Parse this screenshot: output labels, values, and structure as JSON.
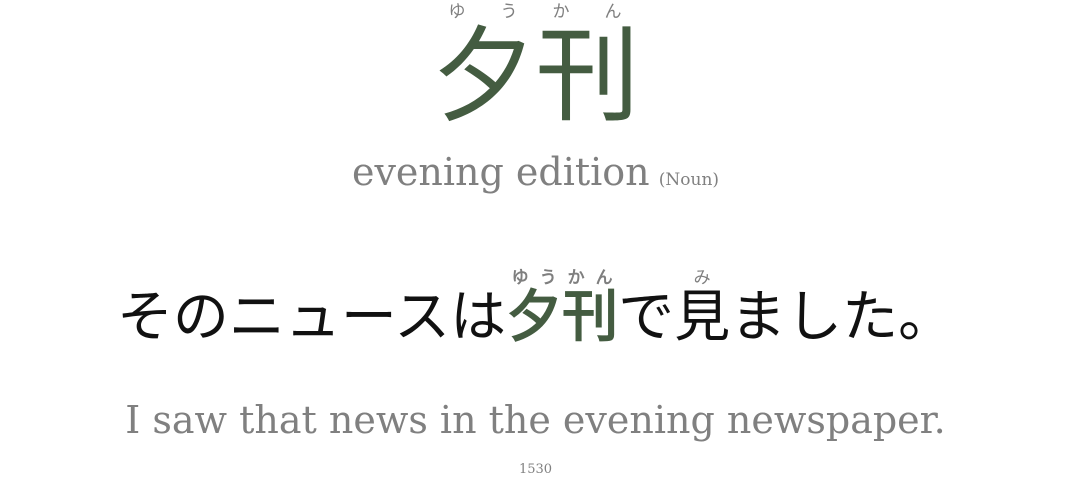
{
  "word": {
    "kanji": "夕刊",
    "reading": "ゆうかん",
    "meaning": "evening edition",
    "part_of_speech": "(Noun)"
  },
  "sentence": {
    "before": "そのニュースは",
    "target": "夕刊",
    "target_reading": "ゆうかん",
    "middle": "で",
    "kanji2": "見",
    "kanji2_reading": "み",
    "after": "ました。"
  },
  "translation": "I saw that news in the evening newspaper.",
  "card_id": "1530",
  "colors": {
    "accent": "#445c41",
    "muted": "#808080",
    "text": "#111111"
  }
}
